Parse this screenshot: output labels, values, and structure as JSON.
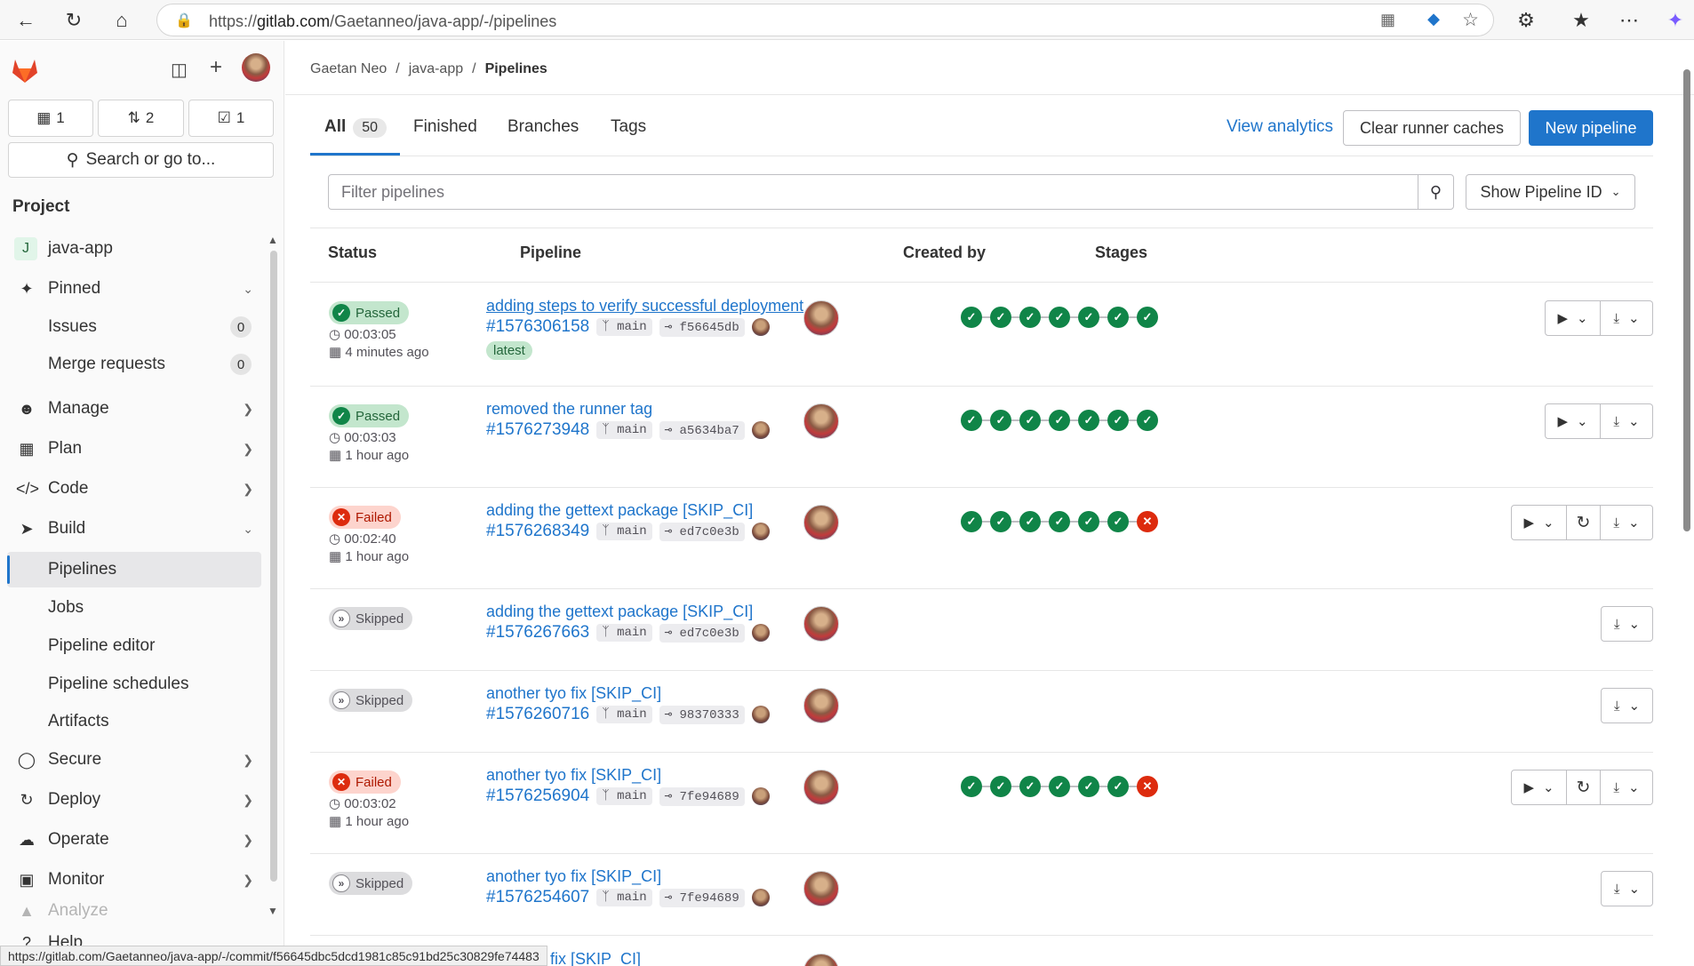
{
  "browser": {
    "url_prefix": "https://",
    "url_host": "gitlab.com",
    "url_path": "/Gaetanneo/java-app/-/pipelines"
  },
  "sidebar": {
    "counts": {
      "issues": "1",
      "merge_requests": "2",
      "todos": "1"
    },
    "search_label": "Search or go to...",
    "section_title": "Project",
    "project_initial": "J",
    "project_name": "java-app",
    "items": {
      "pinned": "Pinned",
      "issues": "Issues",
      "issues_count": "0",
      "merge_requests": "Merge requests",
      "mr_count": "0",
      "manage": "Manage",
      "plan": "Plan",
      "code": "Code",
      "build": "Build",
      "pipelines": "Pipelines",
      "jobs": "Jobs",
      "pipeline_editor": "Pipeline editor",
      "pipeline_schedules": "Pipeline schedules",
      "artifacts": "Artifacts",
      "secure": "Secure",
      "deploy": "Deploy",
      "operate": "Operate",
      "monitor": "Monitor",
      "analyze": "Analyze",
      "help": "Help"
    }
  },
  "breadcrumb": {
    "owner": "Gaetan Neo",
    "project": "java-app",
    "current": "Pipelines",
    "sep": "/"
  },
  "tabs": {
    "all": "All",
    "all_count": "50",
    "finished": "Finished",
    "branches": "Branches",
    "tags": "Tags"
  },
  "header_actions": {
    "analytics": "View analytics",
    "clear_caches": "Clear runner caches",
    "new_pipeline": "New pipeline"
  },
  "filter": {
    "placeholder": "Filter pipelines",
    "show_id": "Show Pipeline ID"
  },
  "columns": {
    "status": "Status",
    "pipeline": "Pipeline",
    "created_by": "Created by",
    "stages": "Stages"
  },
  "rows": [
    {
      "status": "Passed",
      "duration": "00:03:05",
      "when": "4 minutes ago",
      "title": "adding steps to verify successful deployment",
      "id": "#1576306158",
      "branch": "main",
      "sha": "f56645db",
      "tag": "latest"
    },
    {
      "status": "Passed",
      "duration": "00:03:03",
      "when": "1 hour ago",
      "title": "removed the runner tag",
      "id": "#1576273948",
      "branch": "main",
      "sha": "a5634ba7"
    },
    {
      "status": "Failed",
      "duration": "00:02:40",
      "when": "1 hour ago",
      "title": "adding the gettext package [SKIP_CI]",
      "id": "#1576268349",
      "branch": "main",
      "sha": "ed7c0e3b"
    },
    {
      "status": "Skipped",
      "title": "adding the gettext package [SKIP_CI]",
      "id": "#1576267663",
      "branch": "main",
      "sha": "ed7c0e3b"
    },
    {
      "status": "Skipped",
      "title": "another tyo fix [SKIP_CI]",
      "id": "#1576260716",
      "branch": "main",
      "sha": "98370333"
    },
    {
      "status": "Failed",
      "duration": "00:03:02",
      "when": "1 hour ago",
      "title": "another tyo fix [SKIP_CI]",
      "id": "#1576256904",
      "branch": "main",
      "sha": "7fe94689"
    },
    {
      "status": "Skipped",
      "title": "another tyo fix [SKIP_CI]",
      "id": "#1576254607",
      "branch": "main",
      "sha": "7fe94689"
    }
  ],
  "partial_row_title": "yo fix [SKIP_CI]",
  "status_bar": "https://gitlab.com/Gaetanneo/java-app/-/commit/f56645dbc5dcd1981c85c91bd25c30829fe74483",
  "colors": {
    "accent": "#1f75cb",
    "success": "#108548",
    "danger": "#dd2b0e"
  }
}
